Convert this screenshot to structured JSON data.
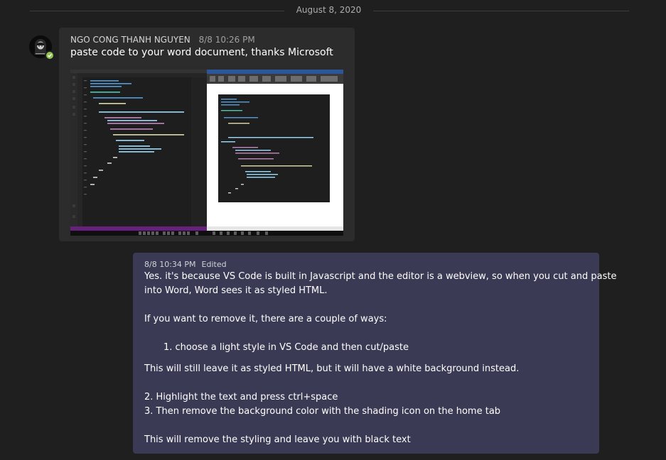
{
  "date_divider": "August 8, 2020",
  "message1": {
    "author": "NGO CONG THANH NGUYEN",
    "timestamp": "8/8 10:26 PM",
    "text": "paste code to your word document, thanks Microsoft",
    "avatar_presence": "available",
    "colors": {
      "presence": "#92c353",
      "bubble": "#2d2c2c"
    }
  },
  "message2": {
    "timestamp": "8/8 10:34 PM",
    "edited_label": "Edited",
    "lines": [
      "Yes. it's because VS Code is built in Javascript and the editor is a webview, so when you cut and paste",
      "into Word, Word sees it as styled HTML.",
      "If you want to remove it, there are a couple of ways:",
      "1. choose a light style in VS Code and then cut/paste",
      "This will still leave it as styled HTML, but it will have a white background instead.",
      "2. Highlight the text and press ctrl+space",
      "3. Then remove the background color with the shading icon on the home tab",
      "This will remove the styling and leave you with black text"
    ],
    "colors": {
      "bubble": "#3b3a55"
    }
  }
}
